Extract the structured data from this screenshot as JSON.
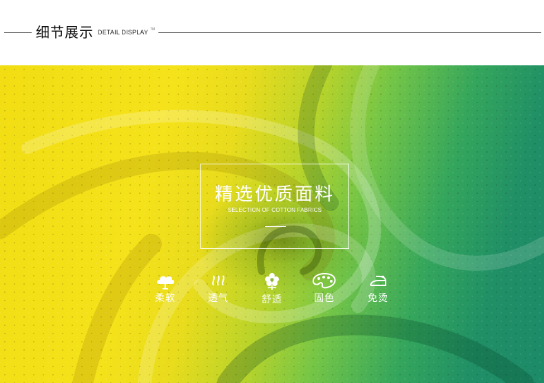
{
  "header": {
    "title": "细节展示",
    "subtitle": "DETAIL DISPLAY",
    "trademark": "TM"
  },
  "overlay": {
    "title": "精选优质面料",
    "subtitle": "SELECTION OF COTTON FABRICS"
  },
  "features": [
    {
      "label": "柔软",
      "icon": "cloud-icon"
    },
    {
      "label": "透气",
      "icon": "airflow-icon"
    },
    {
      "label": "舒适",
      "icon": "flower-icon"
    },
    {
      "label": "固色",
      "icon": "palette-icon"
    },
    {
      "label": "免烫",
      "icon": "iron-icon"
    }
  ],
  "colors": {
    "fabric_yellow": "#f1dd12",
    "fabric_green": "#1d8a68",
    "overlay_text": "#ffffff"
  }
}
